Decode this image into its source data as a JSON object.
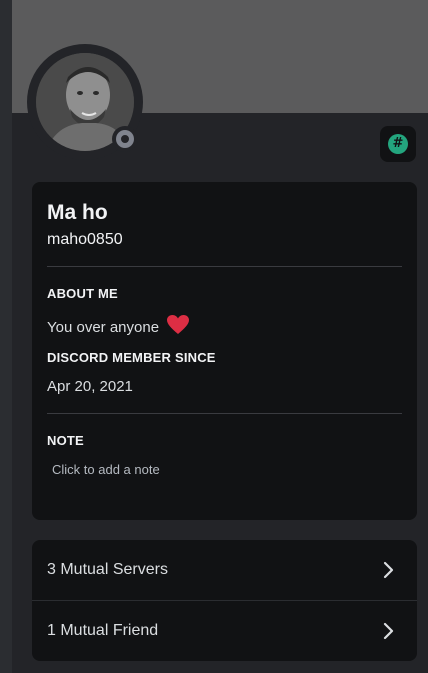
{
  "profile": {
    "display_name": "Ma ho",
    "username": "maho0850",
    "status": "offline"
  },
  "badge": {
    "symbol": "#",
    "color": "#23a57e",
    "icon": "hashtag-badge-icon"
  },
  "about_me": {
    "label": "ABOUT ME",
    "text": "You over anyone",
    "emoji": "heart-icon",
    "emoji_color": "#dd2e44"
  },
  "member_since": {
    "label": "DISCORD MEMBER SINCE",
    "date": "Apr 20, 2021"
  },
  "note": {
    "label": "NOTE",
    "placeholder": "Click to add a note"
  },
  "mutuals": [
    {
      "label": "3 Mutual Servers",
      "icon": "chevron-right-icon"
    },
    {
      "label": "1 Mutual Friend",
      "icon": "chevron-right-icon"
    }
  ],
  "colors": {
    "banner": "#5b5b5c",
    "panel": "#232428",
    "card": "#111214"
  }
}
